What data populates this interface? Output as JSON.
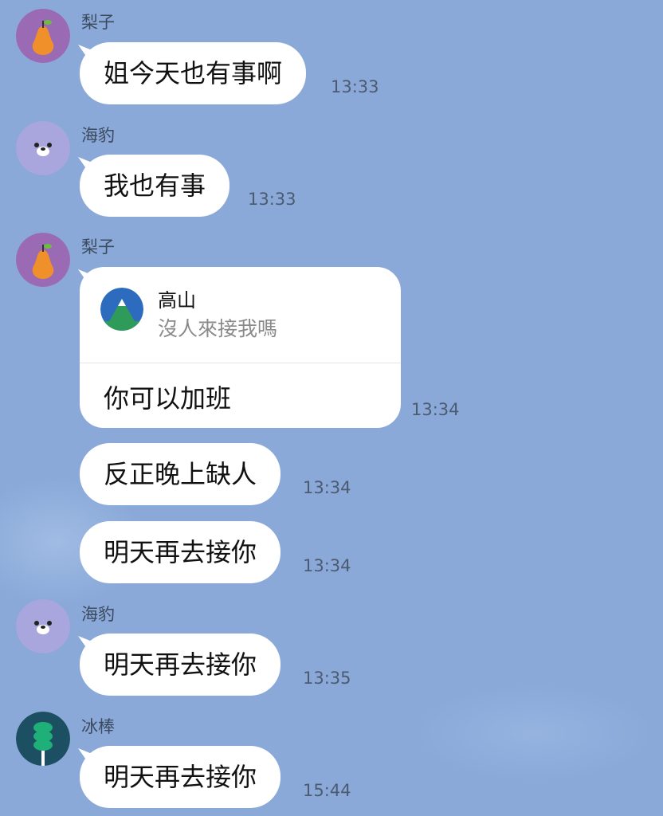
{
  "messages": [
    {
      "sender": "梨子",
      "avatar": "pear-avatar",
      "text": "姐今天也有事啊",
      "time": "13:33"
    },
    {
      "sender": "海豹",
      "avatar": "seal-avatar",
      "text": "我也有事",
      "time": "13:33"
    },
    {
      "sender": "梨子",
      "avatar": "pear-avatar",
      "reply": {
        "name": "高山",
        "quote": "沒人來接我嗎",
        "icon": "mountain-icon"
      },
      "text": "你可以加班",
      "time": "13:34"
    },
    {
      "text": "反正晚上缺人",
      "time": "13:34"
    },
    {
      "text": "明天再去接你",
      "time": "13:34"
    },
    {
      "sender": "海豹",
      "avatar": "seal-avatar",
      "text": "明天再去接你",
      "time": "13:35"
    },
    {
      "sender": "冰棒",
      "avatar": "popsicle-avatar",
      "text": "明天再去接你",
      "time": "15:44"
    }
  ],
  "colors": {
    "background": "#8aa9d9",
    "bubble": "#ffffff",
    "pear_avatar_bg": "#9b6ab4",
    "seal_avatar_bg": "#a8a6dd",
    "popsicle_avatar_bg": "#1d4f63"
  }
}
